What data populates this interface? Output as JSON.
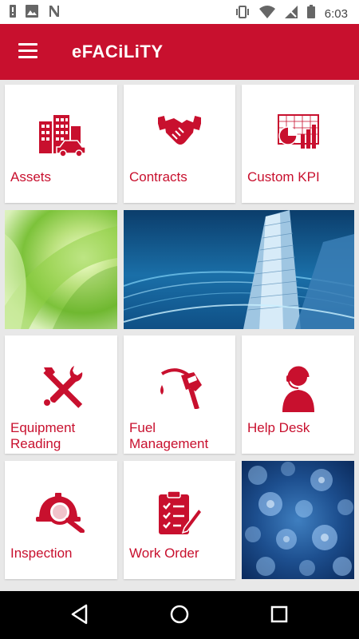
{
  "status_bar": {
    "time": "6:03",
    "left_icons": [
      "alert-icon",
      "image-icon",
      "n-icon"
    ],
    "right_icons": [
      "vibrate-icon",
      "wifi-icon",
      "signal-icon",
      "battery-icon"
    ]
  },
  "app_bar": {
    "title": "eFACiLiTY",
    "menu_icon": "hamburger-menu-icon",
    "color": "#c8102e"
  },
  "tiles": [
    {
      "label": "Assets",
      "icon": "buildings-car-icon"
    },
    {
      "label": "Contracts",
      "icon": "handshake-icon"
    },
    {
      "label": "Custom KPI",
      "icon": "kpi-chart-icon"
    },
    {
      "label": "Equipment Reading",
      "icon": "tools-icon"
    },
    {
      "label": "Fuel Management",
      "icon": "fuel-nozzle-icon"
    },
    {
      "label": "Help Desk",
      "icon": "headset-agent-icon"
    },
    {
      "label": "Inspection",
      "icon": "hardhat-magnifier-icon"
    },
    {
      "label": "Work Order",
      "icon": "clipboard-pen-icon"
    }
  ],
  "images": [
    "green-abstract-image",
    "skyscraper-image",
    "blue-bokeh-image"
  ],
  "nav_bar": {
    "icons": [
      "back-icon",
      "home-icon",
      "recents-icon"
    ]
  }
}
